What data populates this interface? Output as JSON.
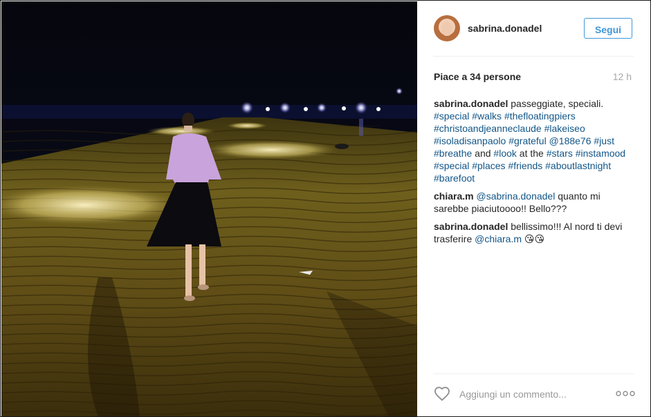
{
  "post": {
    "username": "sabrina.donadel",
    "follow_label": "Segui",
    "likes_text": "Piace a 34 persone",
    "time_ago": "12 h",
    "caption": {
      "user": "sabrina.donadel",
      "text_parts": [
        {
          "t": " passeggiate, speciali. ",
          "tag": false
        },
        {
          "t": "#special",
          "tag": true
        },
        {
          "t": " ",
          "tag": false
        },
        {
          "t": "#walks",
          "tag": true
        },
        {
          "t": " ",
          "tag": false
        },
        {
          "t": "#thefloatingpiers",
          "tag": true
        },
        {
          "t": " ",
          "tag": false
        },
        {
          "t": "#christoandjeanneclaude",
          "tag": true
        },
        {
          "t": " ",
          "tag": false
        },
        {
          "t": "#lakeiseo",
          "tag": true
        },
        {
          "t": " ",
          "tag": false
        },
        {
          "t": "#isoladisanpaolo",
          "tag": true
        },
        {
          "t": " ",
          "tag": false
        },
        {
          "t": "#grateful",
          "tag": true
        },
        {
          "t": " ",
          "tag": false
        },
        {
          "t": "@188e76",
          "tag": true
        },
        {
          "t": " ",
          "tag": false
        },
        {
          "t": "#just",
          "tag": true
        },
        {
          "t": " ",
          "tag": false
        },
        {
          "t": "#breathe",
          "tag": true
        },
        {
          "t": " and ",
          "tag": false
        },
        {
          "t": "#look",
          "tag": true
        },
        {
          "t": " at the ",
          "tag": false
        },
        {
          "t": "#stars",
          "tag": true
        },
        {
          "t": " ",
          "tag": false
        },
        {
          "t": "#instamood",
          "tag": true
        },
        {
          "t": " ",
          "tag": false
        },
        {
          "t": "#special",
          "tag": true
        },
        {
          "t": " ",
          "tag": false
        },
        {
          "t": "#places",
          "tag": true
        },
        {
          "t": " ",
          "tag": false
        },
        {
          "t": "#friends",
          "tag": true
        },
        {
          "t": " ",
          "tag": false
        },
        {
          "t": "#aboutlastnight",
          "tag": true
        },
        {
          "t": " ",
          "tag": false
        },
        {
          "t": "#barefoot",
          "tag": true
        }
      ]
    },
    "comments": [
      {
        "user": "chiara.m",
        "text_parts": [
          {
            "t": " ",
            "tag": false
          },
          {
            "t": "@sabrina.donadel",
            "tag": true
          },
          {
            "t": " quanto mi sarebbe piaciutoooo!! Bello???",
            "tag": false
          }
        ]
      },
      {
        "user": "sabrina.donadel",
        "text_parts": [
          {
            "t": " bellissimo!!! Al nord ti devi trasferire ",
            "tag": false
          },
          {
            "t": "@chiara.m",
            "tag": true
          },
          {
            "t": " 😘😘",
            "tag": false
          }
        ]
      }
    ],
    "comment_placeholder": "Aggiungi un commento...",
    "icons": {
      "like": "heart-outline-icon",
      "more": "more-options-icon"
    },
    "colors": {
      "link": "#125688",
      "follow": "#3f96d9",
      "muted": "#a5a7aa"
    }
  }
}
